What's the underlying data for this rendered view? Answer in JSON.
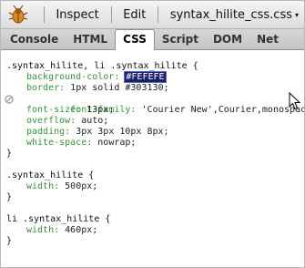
{
  "toolbar": {
    "inspect_label": "Inspect",
    "edit_label": "Edit",
    "file_label": "syntax_hilite_css.css",
    "file_caret": "▾"
  },
  "tabs": [
    {
      "label": "Console",
      "active": false
    },
    {
      "label": "HTML",
      "active": false
    },
    {
      "label": "CSS",
      "active": true
    },
    {
      "label": "Script",
      "active": false
    },
    {
      "label": "DOM",
      "active": false
    },
    {
      "label": "Net",
      "active": false
    }
  ],
  "css": {
    "rule1": {
      "selector": ".syntax_hilite, li .syntax_hilite {",
      "decl_bg_prop": "background-color:",
      "decl_bg_value": "#FEFEFE",
      "decl_border_prop": "border:",
      "decl_border_value": "1px solid #303130;",
      "decl_font_family_prop": "font-family:",
      "decl_font_family_value": "'Courier New',Courier,monospace;",
      "decl_font_size_prop": "font-size:",
      "decl_font_size_value": "13px;",
      "decl_overflow_prop": "overflow:",
      "decl_overflow_value": "auto;",
      "decl_padding_prop": "padding:",
      "decl_padding_value": "3px 3px 10px 8px;",
      "decl_whitespace_prop": "white-space:",
      "decl_whitespace_value": "nowrap;",
      "close": "}"
    },
    "rule2": {
      "selector": ".syntax_hilite {",
      "decl_width_prop": "width:",
      "decl_width_value": "500px;",
      "close": "}"
    },
    "rule3": {
      "selector": "li .syntax_hilite {",
      "decl_width_prop": "width:",
      "decl_width_value": "460px;",
      "close": "}"
    }
  },
  "icons": {
    "firebug": "firebug-icon",
    "disabled": "disabled-property-icon",
    "cursor": "mouse-cursor-icon"
  }
}
